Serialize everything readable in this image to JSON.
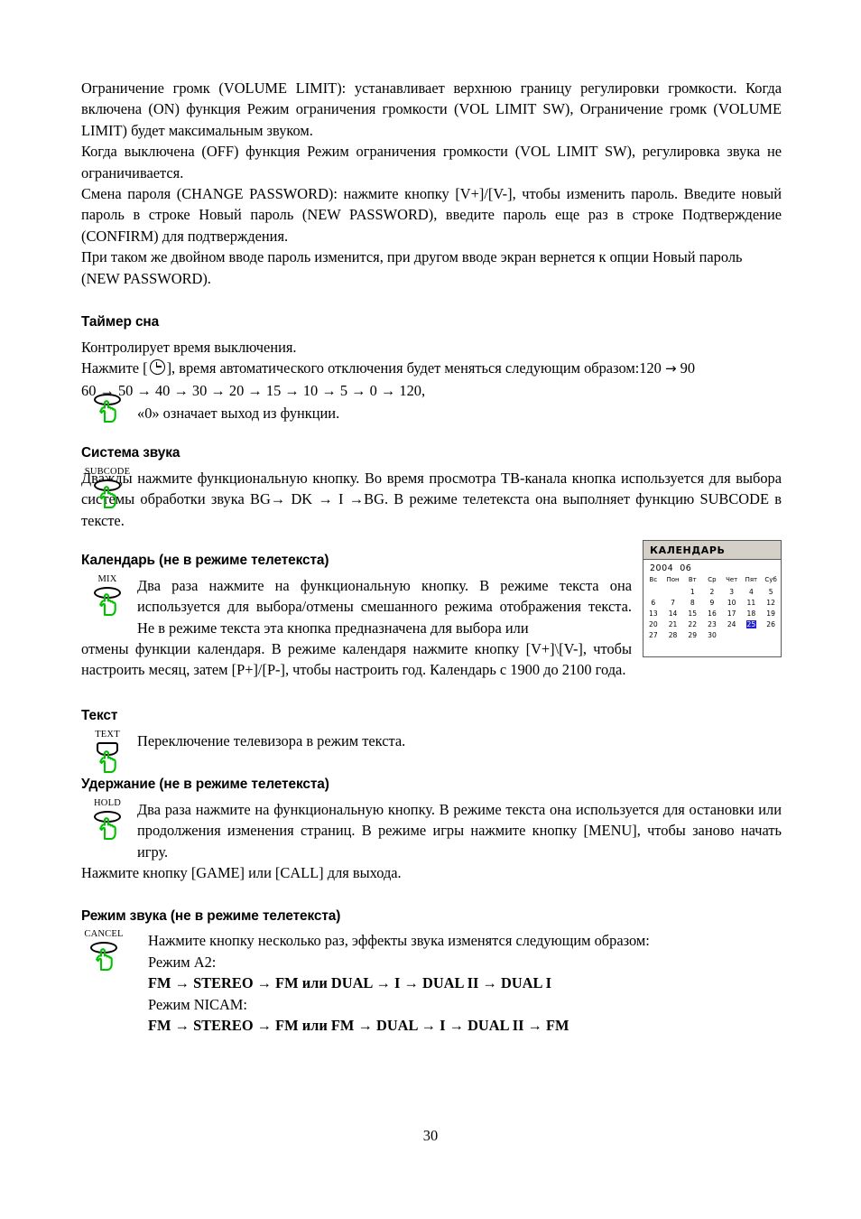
{
  "document": {
    "page_number": "30",
    "language": "ru"
  },
  "intro": {
    "paragraphs": [
      "Ограничение громк (VOLUME LIMIT): устанавливает верхнюю границу регулировки громкости. Когда включена (ON) функция Режим ограничения громкости (VOL LIMIT SW), Ограничение громк (VOLUME LIMIT) будет максимальным звуком.",
      "Когда выключена (OFF) функция Режим ограничения громкости (VOL LIMIT SW), регулировка звука не ограничивается.",
      "Смена пароля (CHANGE PASSWORD): нажмите кнопку   [V+]/[V-], чтобы изменить пароль. Введите новый пароль в строке Новый пароль (NEW PASSWORD), введите пароль еще раз в строке Подтверждение (CONFIRM) для подтверждения.",
      "При таком же двойном вводе пароль изменится, при другом вводе экран вернется к опции Новый пароль (NEW PASSWORD)."
    ]
  },
  "sections": {
    "sleep_timer": {
      "heading": "Таймер сна",
      "line1": "Контролирует время выключения.",
      "line2_before_icon": "Нажмите [",
      "line2_after_icon": "], время автоматического отключения будет меняться следующим образом:120",
      "sequence_head": "90",
      "sequence_rest": "60 → 50 → 40 → 30 → 20 → 15 → 10 → 5 → 0 → 120,",
      "note": "«0» означает выход из функции.",
      "icon_caption": ""
    },
    "sound_system": {
      "heading": "Система звука",
      "icon_caption": "SUBCODE",
      "text": "Дважды нажмите функциональную кнопку. Во время просмотра ТВ-канала кнопка используется для выбора системы обработки звука BG→ DK → I →BG. В режиме телетекста она выполняет функцию SUBCODE в тексте."
    },
    "calendar": {
      "heading": "Календарь (не в режиме телетекста)",
      "icon_caption": "MIX",
      "text_indented": "Два раза нажмите на функциональную кнопку. В режиме текста она используется для выбора/отмены смешанного режима отображения текста. Не в режиме текста эта кнопка предназначена для выбора или",
      "text_full": "отмены функции календаря. В режиме календаря нажмите кнопку [V+]\\[V-], чтобы настроить месяц, затем [P+]/[P-], чтобы настроить год. Календарь с 1900 до 2100 года."
    },
    "text_mode": {
      "heading": "Текст",
      "icon_caption": "TEXT",
      "text": "Переключение телевизора в режим текста."
    },
    "hold": {
      "heading": "Удержание (не в режиме телетекста)",
      "icon_caption": "HOLD",
      "text_indented": "Два раза нажмите на функциональную кнопку. В режиме текста она используется для остановки или продолжения изменения страниц. В режиме игры нажмите кнопку [MENU], чтобы заново начать игру.",
      "text_full": "Нажмите кнопку [GAME] или [CALL] для выхода."
    },
    "sound_mode": {
      "heading": "Режим звука (не в режиме телетекста)",
      "icon_caption": "CANCEL",
      "line1": "Нажмите кнопку несколько раз, эффекты звука изменятся следующим образом:",
      "line2": "Режим A2:",
      "line3": "FM → STEREO → FM или DUAL → I → DUAL II → DUAL I",
      "line4": "Режим NICAM:",
      "line5": "FM → STEREO → FM или FM → DUAL → I → DUAL II → FM"
    }
  },
  "calendar_widget": {
    "title": "КАЛЕНДАРЬ",
    "year": "2004",
    "month": "06",
    "weekday_headers": [
      "Вс",
      "Пон",
      "Вт",
      "Ср",
      "Чет",
      "Пят",
      "Суб"
    ],
    "weeks": [
      [
        "",
        "",
        "1",
        "2",
        "3",
        "4",
        "5"
      ],
      [
        "6",
        "7",
        "8",
        "9",
        "10",
        "11",
        "12"
      ],
      [
        "13",
        "14",
        "15",
        "16",
        "17",
        "18",
        "19"
      ],
      [
        "20",
        "21",
        "22",
        "23",
        "24",
        "25",
        "26"
      ],
      [
        "27",
        "28",
        "29",
        "30",
        "",
        "",
        ""
      ]
    ],
    "selected_day": "25",
    "colors": {
      "title_bg": "#d4d0c8",
      "border": "#5a5a5a",
      "selected_bg": "#2020d8",
      "selected_fg": "#ffffff"
    }
  },
  "icon_colors": {
    "hand_green": "#00c000"
  }
}
